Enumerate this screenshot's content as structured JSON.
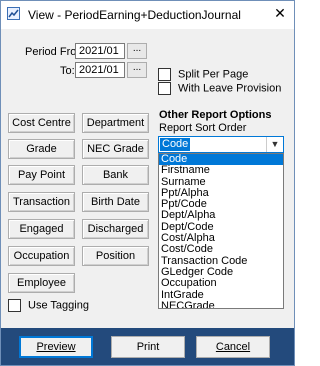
{
  "window": {
    "title": "View - PeriodEarning+DeductionJournal",
    "close_symbol": "✕"
  },
  "period": {
    "from_label": "Period From:",
    "from_value": "2021/01",
    "to_label": "To:",
    "to_value": "2021/01",
    "browse_label": "..."
  },
  "options": {
    "split_per_page": "Split Per Page",
    "with_leave_provision": "With Leave Provision"
  },
  "grouping_buttons": [
    "Cost Centre",
    "Department",
    "Grade",
    "NEC Grade",
    "Pay Point",
    "Bank",
    "Transaction",
    "Birth Date",
    "Engaged",
    "Discharged",
    "Occupation",
    "Position",
    "Employee"
  ],
  "use_tagging": "Use Tagging",
  "other_options": {
    "title": "Other Report Options",
    "sort_label": "Report Sort Order",
    "selected": "Code",
    "items": [
      "Code",
      "Firstname",
      "Surname",
      "Ppt/Alpha",
      "Ppt/Code",
      "Dept/Alpha",
      "Dept/Code",
      "Cost/Alpha",
      "Cost/Code",
      "Transaction Code",
      "GLedger Code",
      "Occupation",
      "IntGrade",
      "NECGrade"
    ]
  },
  "footer": {
    "preview": "Preview",
    "print": "Print",
    "cancel": "Cancel"
  },
  "colors": {
    "footer_bg": "#234a7c",
    "selection": "#0078d7"
  }
}
